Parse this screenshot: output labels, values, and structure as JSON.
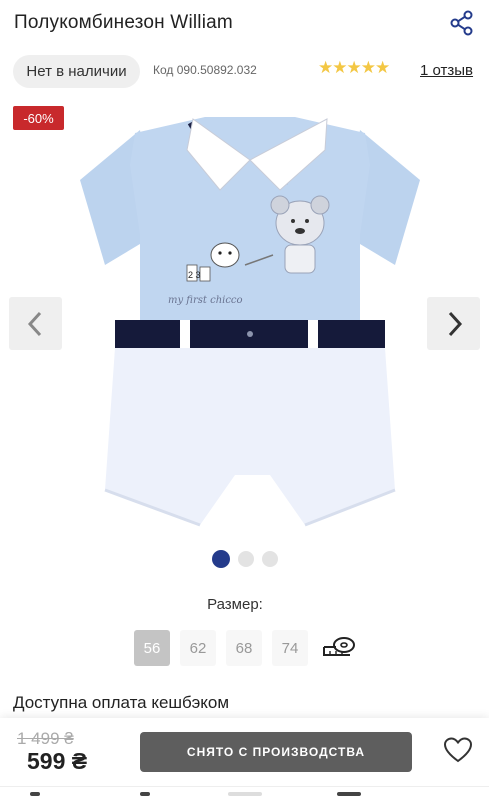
{
  "product": {
    "title": "Полукомбинезон William",
    "availability": "Нет в наличии",
    "sku": "Код 090.50892.032",
    "rating_stars": "★★★★★",
    "rating_value": 5,
    "reviews_link": "1 отзыв",
    "discount_badge": "-60%"
  },
  "gallery": {
    "current_index": 1,
    "total": 3,
    "image_print_text": "my first chicco",
    "image_numbers": "2 3"
  },
  "sizes": {
    "label": "Размер:",
    "options": [
      "56",
      "62",
      "68",
      "74"
    ],
    "selected": "56"
  },
  "cashback": "Доступна оплата кешбэком",
  "purchase": {
    "old_price": "1 499 ₴",
    "new_price": "599 ₴",
    "button_label": "СНЯТО С ПРОИЗВОДСТВА"
  },
  "icons": {
    "share": "share-icon",
    "prev": "chevron-left-icon",
    "next": "chevron-right-icon",
    "size_guide": "measuring-tape-icon",
    "favorite": "heart-icon"
  },
  "colors": {
    "discount": "#c8292c",
    "star": "#f3c744",
    "active_dot": "#243b8b",
    "button": "#5e5e5e"
  }
}
